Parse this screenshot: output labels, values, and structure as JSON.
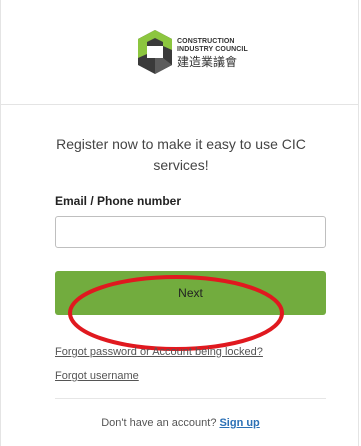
{
  "brand": {
    "name_en_line1": "CONSTRUCTION",
    "name_en_line2": "INDUSTRY COUNCIL",
    "name_zh": "建造業議會",
    "accent_color": "#8cc63f",
    "button_color": "#72ac3e"
  },
  "form": {
    "heading": "Register now to make it easy to use CIC services!",
    "email_label": "Email / Phone number",
    "email_value": "",
    "email_placeholder": "",
    "next_label": "Next"
  },
  "links": {
    "forgot_password": "Forgot password or Account being locked?",
    "forgot_username": "Forgot username"
  },
  "signup": {
    "prompt": "Don't have an account?",
    "link_label": "Sign up"
  },
  "annotation": {
    "highlight_color": "#e0191f",
    "target": "next-button"
  }
}
